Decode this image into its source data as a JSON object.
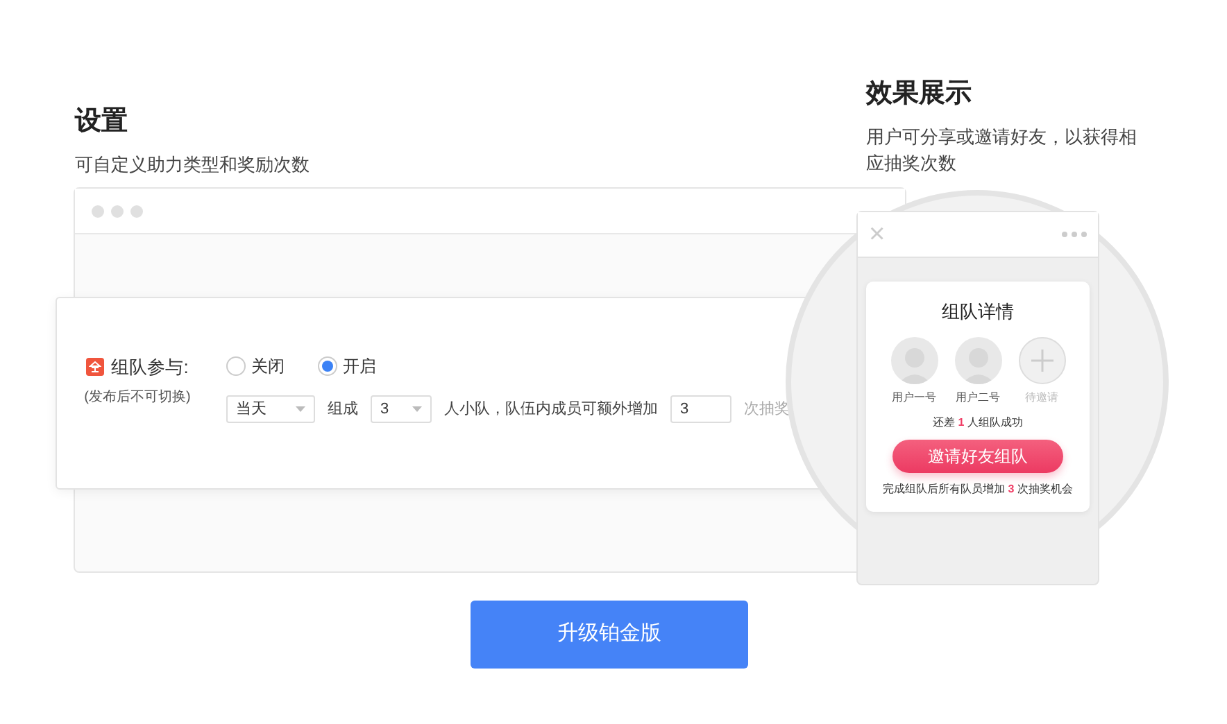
{
  "settings": {
    "title": "设置",
    "subtitle": "可自定义助力类型和奖励次数"
  },
  "team_setting": {
    "label": "组队参与:",
    "note": "(发布后不可切换)",
    "options": [
      {
        "label": "关闭",
        "selected": false
      },
      {
        "label": "开启",
        "selected": true
      }
    ],
    "period": "当天",
    "text_1": "组成",
    "team_size": "3",
    "text_2": "人小队，队伍内成员可额外增加",
    "extra_draws": "3",
    "text_3": "次抽奖"
  },
  "preview": {
    "title": "效果展示",
    "subtitle": "用户可分享或邀请好友，以获得相应抽奖次数"
  },
  "phone": {
    "close": "×",
    "card_title": "组队详情",
    "members": [
      {
        "kind": "user",
        "label": "用户一号"
      },
      {
        "kind": "user",
        "label": "用户二号"
      },
      {
        "kind": "invite",
        "label": "待邀请"
      }
    ],
    "remaining": {
      "before": "还差",
      "count": "1",
      "after": "人组队成功"
    },
    "invite_button": "邀请好友组队",
    "reward": {
      "before": "完成组队后所有队员增加",
      "count": "3",
      "after": "次抽奖机会"
    }
  },
  "upgrade_button": "升级铂金版"
}
